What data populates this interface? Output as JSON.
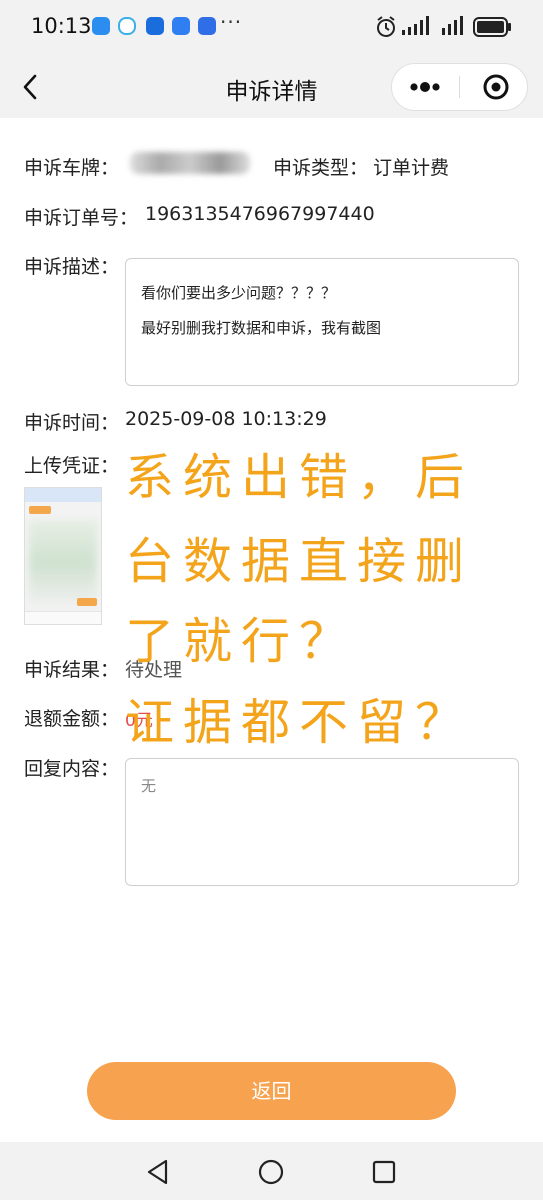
{
  "status_bar": {
    "time": "10:13",
    "more": "···"
  },
  "nav": {
    "title": "申诉详情",
    "more_icon": "more-dots-icon",
    "close_icon": "target-close-icon"
  },
  "fields": {
    "plate_label": "申诉车牌：",
    "type_label": "申诉类型：",
    "type_value": "订单计费",
    "order_label": "申诉订单号：",
    "order_value": "1963135476967997440",
    "desc_label": "申诉描述：",
    "desc_lines": [
      "看你们要出多少问题？？？？",
      "最好别删我打数据和申诉，我有截图"
    ],
    "time_label": "申诉时间：",
    "time_value": "2025-09-08 10:13:29",
    "upload_label": "上传凭证：",
    "result_label": "申诉结果：",
    "result_value": "待处理",
    "refund_label": "退额金额：",
    "refund_value": "0元",
    "reply_label": "回复内容：",
    "reply_value": "无"
  },
  "overlay_text": [
    "系统出错，后",
    "台数据直接删",
    "了就行？",
    "证据都不留？"
  ],
  "buttons": {
    "return_label": "返回"
  },
  "colors": {
    "accent": "#f7a24f",
    "overlay": "#f3a41b",
    "refund": "#e34d4d",
    "bar_bg": "#f2f2f2"
  }
}
